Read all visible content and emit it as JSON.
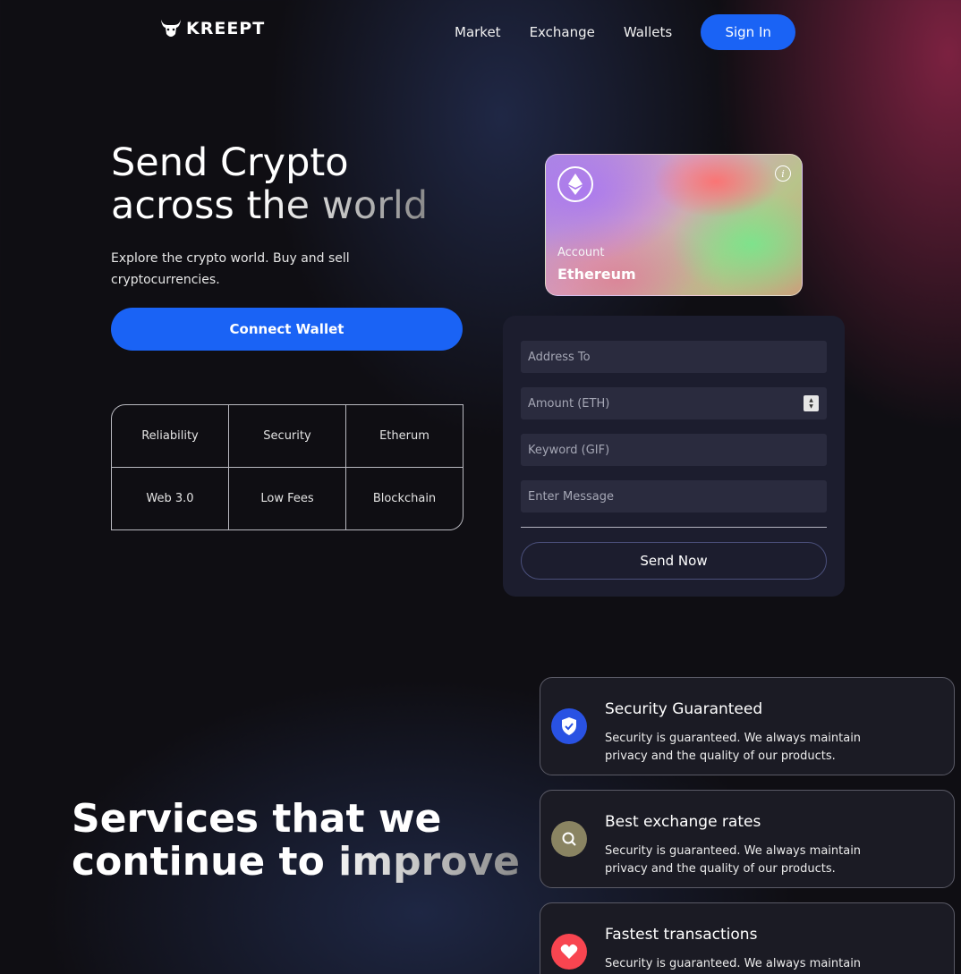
{
  "brand": {
    "name": "KREEPT",
    "logo_icon": "bull-head-icon"
  },
  "nav": {
    "links": [
      "Market",
      "Exchange",
      "Wallets"
    ],
    "signin_label": "Sign In",
    "accent": "#1a63f5"
  },
  "hero": {
    "title_line1": "Send Crypto",
    "title_line2": "across the world",
    "subtitle": "Explore the crypto world. Buy and sell cryptocurrencies.",
    "connect_label": "Connect Wallet",
    "features": [
      "Reliability",
      "Security",
      "Etherum",
      "Web 3.0",
      "Low Fees",
      "Blockchain"
    ]
  },
  "card": {
    "icon": "ethereum-icon",
    "info_icon": "info-icon",
    "account_label": "Account",
    "account_name": "Ethereum"
  },
  "form": {
    "address_placeholder": "Address To",
    "amount_placeholder": "Amount (ETH)",
    "keyword_placeholder": "Keyword (GIF)",
    "message_placeholder": "Enter Message",
    "send_label": "Send Now"
  },
  "services": {
    "title_line1": "Services that we",
    "title_line2": "continue to improve",
    "items": [
      {
        "title": "Security Guaranteed",
        "desc": "Security is guaranteed. We always maintain privacy and the quality of our products.",
        "icon": "shield-check-icon",
        "color": "#2952e3"
      },
      {
        "title": "Best exchange rates",
        "desc": "Security is guaranteed. We always maintain privacy and the quality of our products.",
        "icon": "search-icon",
        "color": "#8a8462"
      },
      {
        "title": "Fastest transactions",
        "desc": "Security is guaranteed. We always maintain",
        "icon": "heart-icon",
        "color": "#f84550"
      }
    ]
  }
}
